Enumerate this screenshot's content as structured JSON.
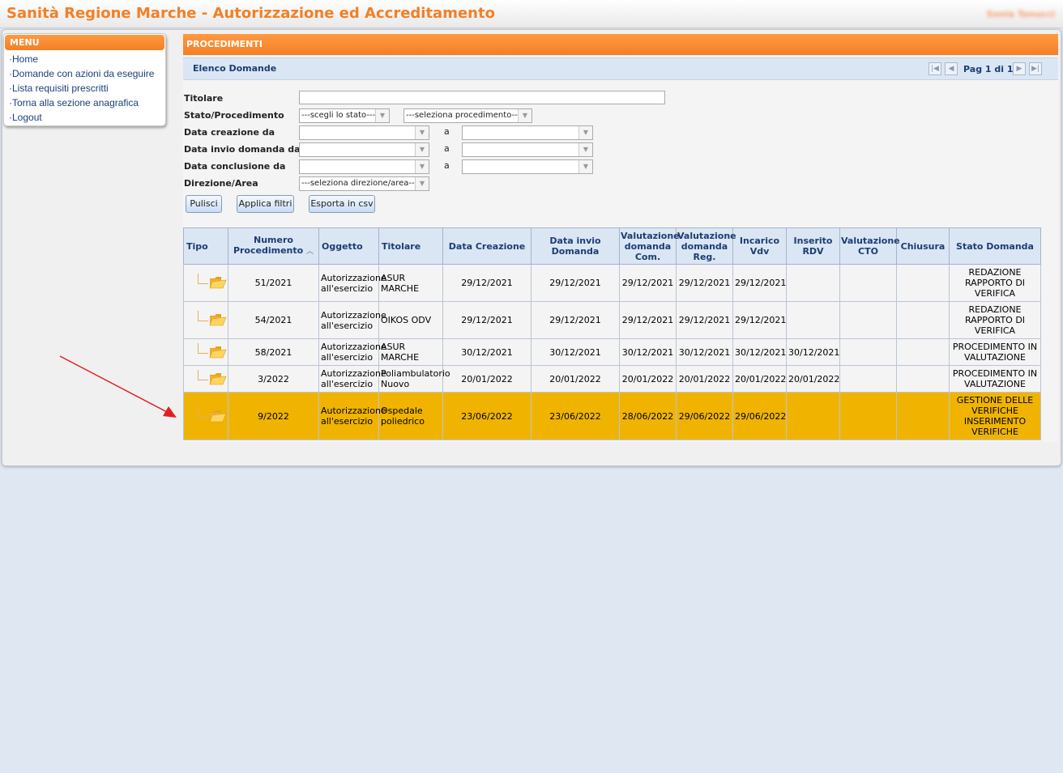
{
  "app": {
    "title": "Sanità Regione Marche - Autorizzazione ed Accreditamento",
    "user": "Sonia Tonucci"
  },
  "menu": {
    "header": "MENU",
    "items": [
      "·Home",
      "·Domande con azioni da eseguire",
      "·Lista requisiti prescritti",
      "·Torna alla sezione anagrafica",
      "·Logout"
    ]
  },
  "section": {
    "title": "PROCEDIMENTI"
  },
  "list": {
    "title": "Elenco Domande",
    "page_label": "Pag 1 di 1"
  },
  "filters": {
    "titolare_label": "Titolare",
    "stato_label": "Stato/Procedimento",
    "stato_value": "---scegli lo stato---",
    "procedimento_value": "---seleziona procedimento---",
    "data_creazione_label": "Data creazione da",
    "data_invio_label": "Data invio domanda da",
    "data_conclusione_label": "Data conclusione da",
    "a_label": "a",
    "direzione_label": "Direzione/Area",
    "direzione_value": "---seleziona direzione/area---"
  },
  "buttons": {
    "pulisci": "Pulisci",
    "applica": "Applica filtri",
    "esporta": "Esporta in csv"
  },
  "table": {
    "headers": {
      "tipo": "Tipo",
      "numero": "Numero Procedimento",
      "oggetto": "Oggetto",
      "titolare": "Titolare",
      "data_creazione": "Data Creazione",
      "data_invio": "Data invio Domanda",
      "val_com": "Valutazione domanda Com.",
      "val_reg": "Valutazione domanda Reg.",
      "incarico": "Incarico Vdv",
      "inserito": "Inserito RDV",
      "val_cto": "Valutazione CTO",
      "chiusura": "Chiusura",
      "stato": "Stato Domanda"
    },
    "rows": [
      {
        "numero": "51/2021",
        "oggetto": "Autorizzazione all'esercizio",
        "titolare": "ASUR MARCHE",
        "data_creazione": "29/12/2021",
        "data_invio": "29/12/2021",
        "val_com": "29/12/2021",
        "val_reg": "29/12/2021",
        "incarico": "29/12/2021",
        "inserito": "",
        "val_cto": "",
        "chiusura": "",
        "stato": "REDAZIONE RAPPORTO DI VERIFICA"
      },
      {
        "numero": "54/2021",
        "oggetto": "Autorizzazione all'esercizio",
        "titolare": "OIKOS ODV",
        "data_creazione": "29/12/2021",
        "data_invio": "29/12/2021",
        "val_com": "29/12/2021",
        "val_reg": "29/12/2021",
        "incarico": "29/12/2021",
        "inserito": "",
        "val_cto": "",
        "chiusura": "",
        "stato": "REDAZIONE RAPPORTO DI VERIFICA"
      },
      {
        "numero": "58/2021",
        "oggetto": "Autorizzazione all'esercizio",
        "titolare": "ASUR MARCHE",
        "data_creazione": "30/12/2021",
        "data_invio": "30/12/2021",
        "val_com": "30/12/2021",
        "val_reg": "30/12/2021",
        "incarico": "30/12/2021",
        "inserito": "30/12/2021",
        "val_cto": "",
        "chiusura": "",
        "stato": "PROCEDIMENTO IN VALUTAZIONE"
      },
      {
        "numero": "3/2022",
        "oggetto": "Autorizzazione all'esercizio",
        "titolare": "Poliambulatorio Nuovo",
        "data_creazione": "20/01/2022",
        "data_invio": "20/01/2022",
        "val_com": "20/01/2022",
        "val_reg": "20/01/2022",
        "incarico": "20/01/2022",
        "inserito": "20/01/2022",
        "val_cto": "",
        "chiusura": "",
        "stato": "PROCEDIMENTO IN VALUTAZIONE"
      },
      {
        "numero": "9/2022",
        "oggetto": "Autorizzazione all'esercizio",
        "titolare": "Ospedale poliedrico",
        "data_creazione": "23/06/2022",
        "data_invio": "23/06/2022",
        "val_com": "28/06/2022",
        "val_reg": "29/06/2022",
        "incarico": "29/06/2022",
        "inserito": "",
        "val_cto": "",
        "chiusura": "",
        "stato": "GESTIONE DELLE VERIFICHE INSERIMENTO VERIFICHE"
      }
    ]
  },
  "colors": {
    "accent": "#f47f25",
    "highlight_row": "#f0b400",
    "header_blue": "#dbe6f4",
    "annotation_arrow": "#e02020"
  }
}
